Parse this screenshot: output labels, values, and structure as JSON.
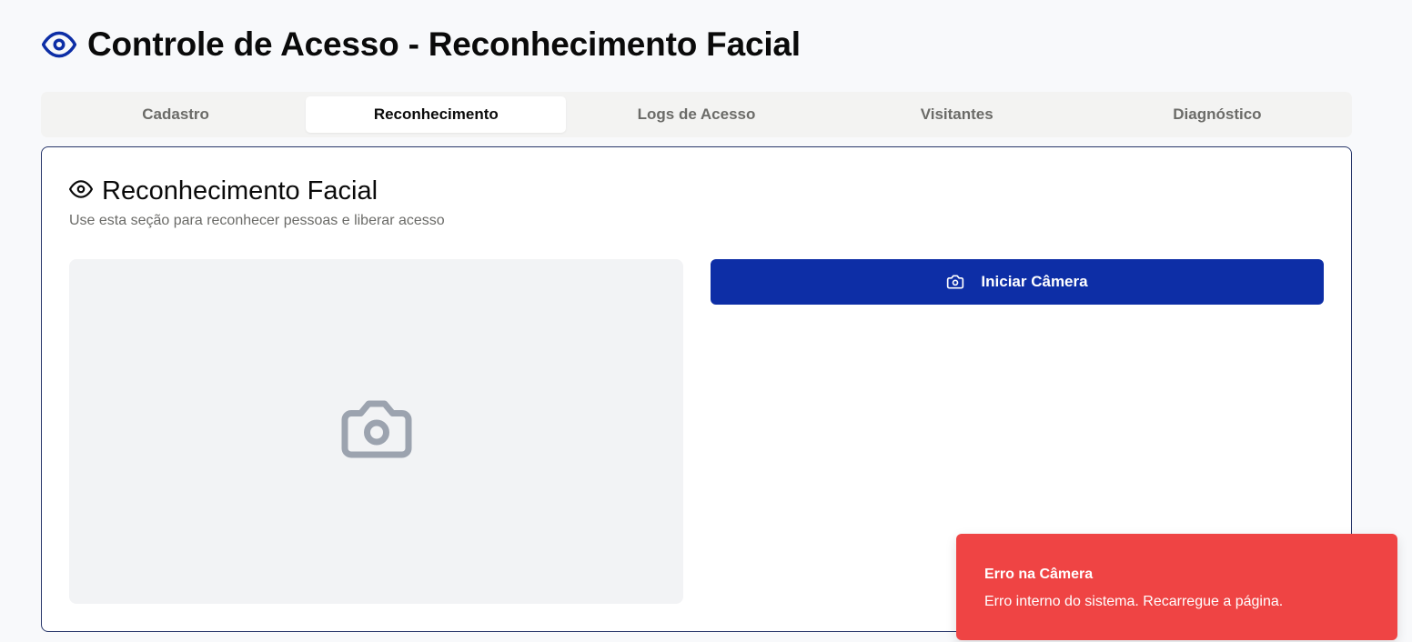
{
  "header": {
    "title": "Controle de Acesso - Reconhecimento Facial",
    "icon": "eye-icon",
    "icon_color": "#0d2ea6"
  },
  "tabs": [
    {
      "label": "Cadastro",
      "active": false
    },
    {
      "label": "Reconhecimento",
      "active": true
    },
    {
      "label": "Logs de Acesso",
      "active": false
    },
    {
      "label": "Visitantes",
      "active": false
    },
    {
      "label": "Diagnóstico",
      "active": false
    }
  ],
  "card": {
    "title": "Reconhecimento Facial",
    "title_icon": "eye-icon",
    "subtitle": "Use esta seção para reconhecer pessoas e liberar acesso",
    "preview_icon": "camera-icon",
    "start_button": {
      "label": "Iniciar Câmera",
      "icon": "camera-icon",
      "color": "#0d2ea6"
    }
  },
  "toast": {
    "title": "Erro na Câmera",
    "message": "Erro interno do sistema. Recarregue a página.",
    "color": "#ef4444"
  }
}
